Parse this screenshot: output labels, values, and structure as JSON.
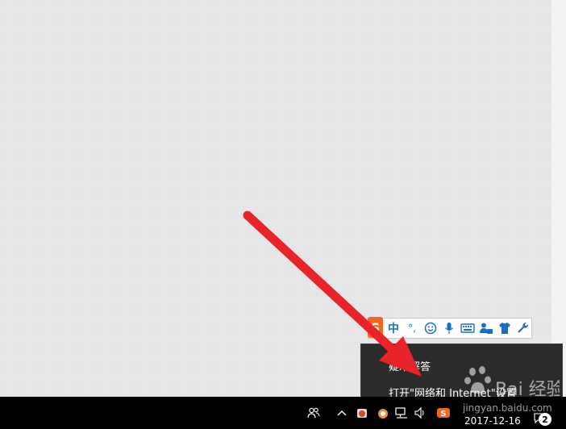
{
  "ime_toolbar": {
    "logo_text": "S",
    "mode_label": "中",
    "punct_label": "°,",
    "buttons": [
      "emoji-icon",
      "microphone-icon",
      "keyboard-icon",
      "user-settings-icon",
      "skin-icon",
      "wrench-icon"
    ]
  },
  "context_menu": {
    "items": [
      "疑难解答",
      "打开\"网络和 Internet\"设置"
    ]
  },
  "taskbar": {
    "clock_date": "2017-12-16",
    "notification_count": "2",
    "tray_icons": [
      "people-icon",
      "chevron-up-icon",
      "app-icon-1",
      "app-icon-2",
      "network-icon",
      "volume-icon",
      "sogou-icon"
    ]
  },
  "watermark": {
    "text_cn": "Bai 经验",
    "url": "jingyan.baidu.com"
  },
  "colors": {
    "arrow": "#e8232a",
    "taskbar": "#000000",
    "menu": "#2b2b2b",
    "ime_accent": "#1a6fc4",
    "ime_logo": "#f26522"
  }
}
